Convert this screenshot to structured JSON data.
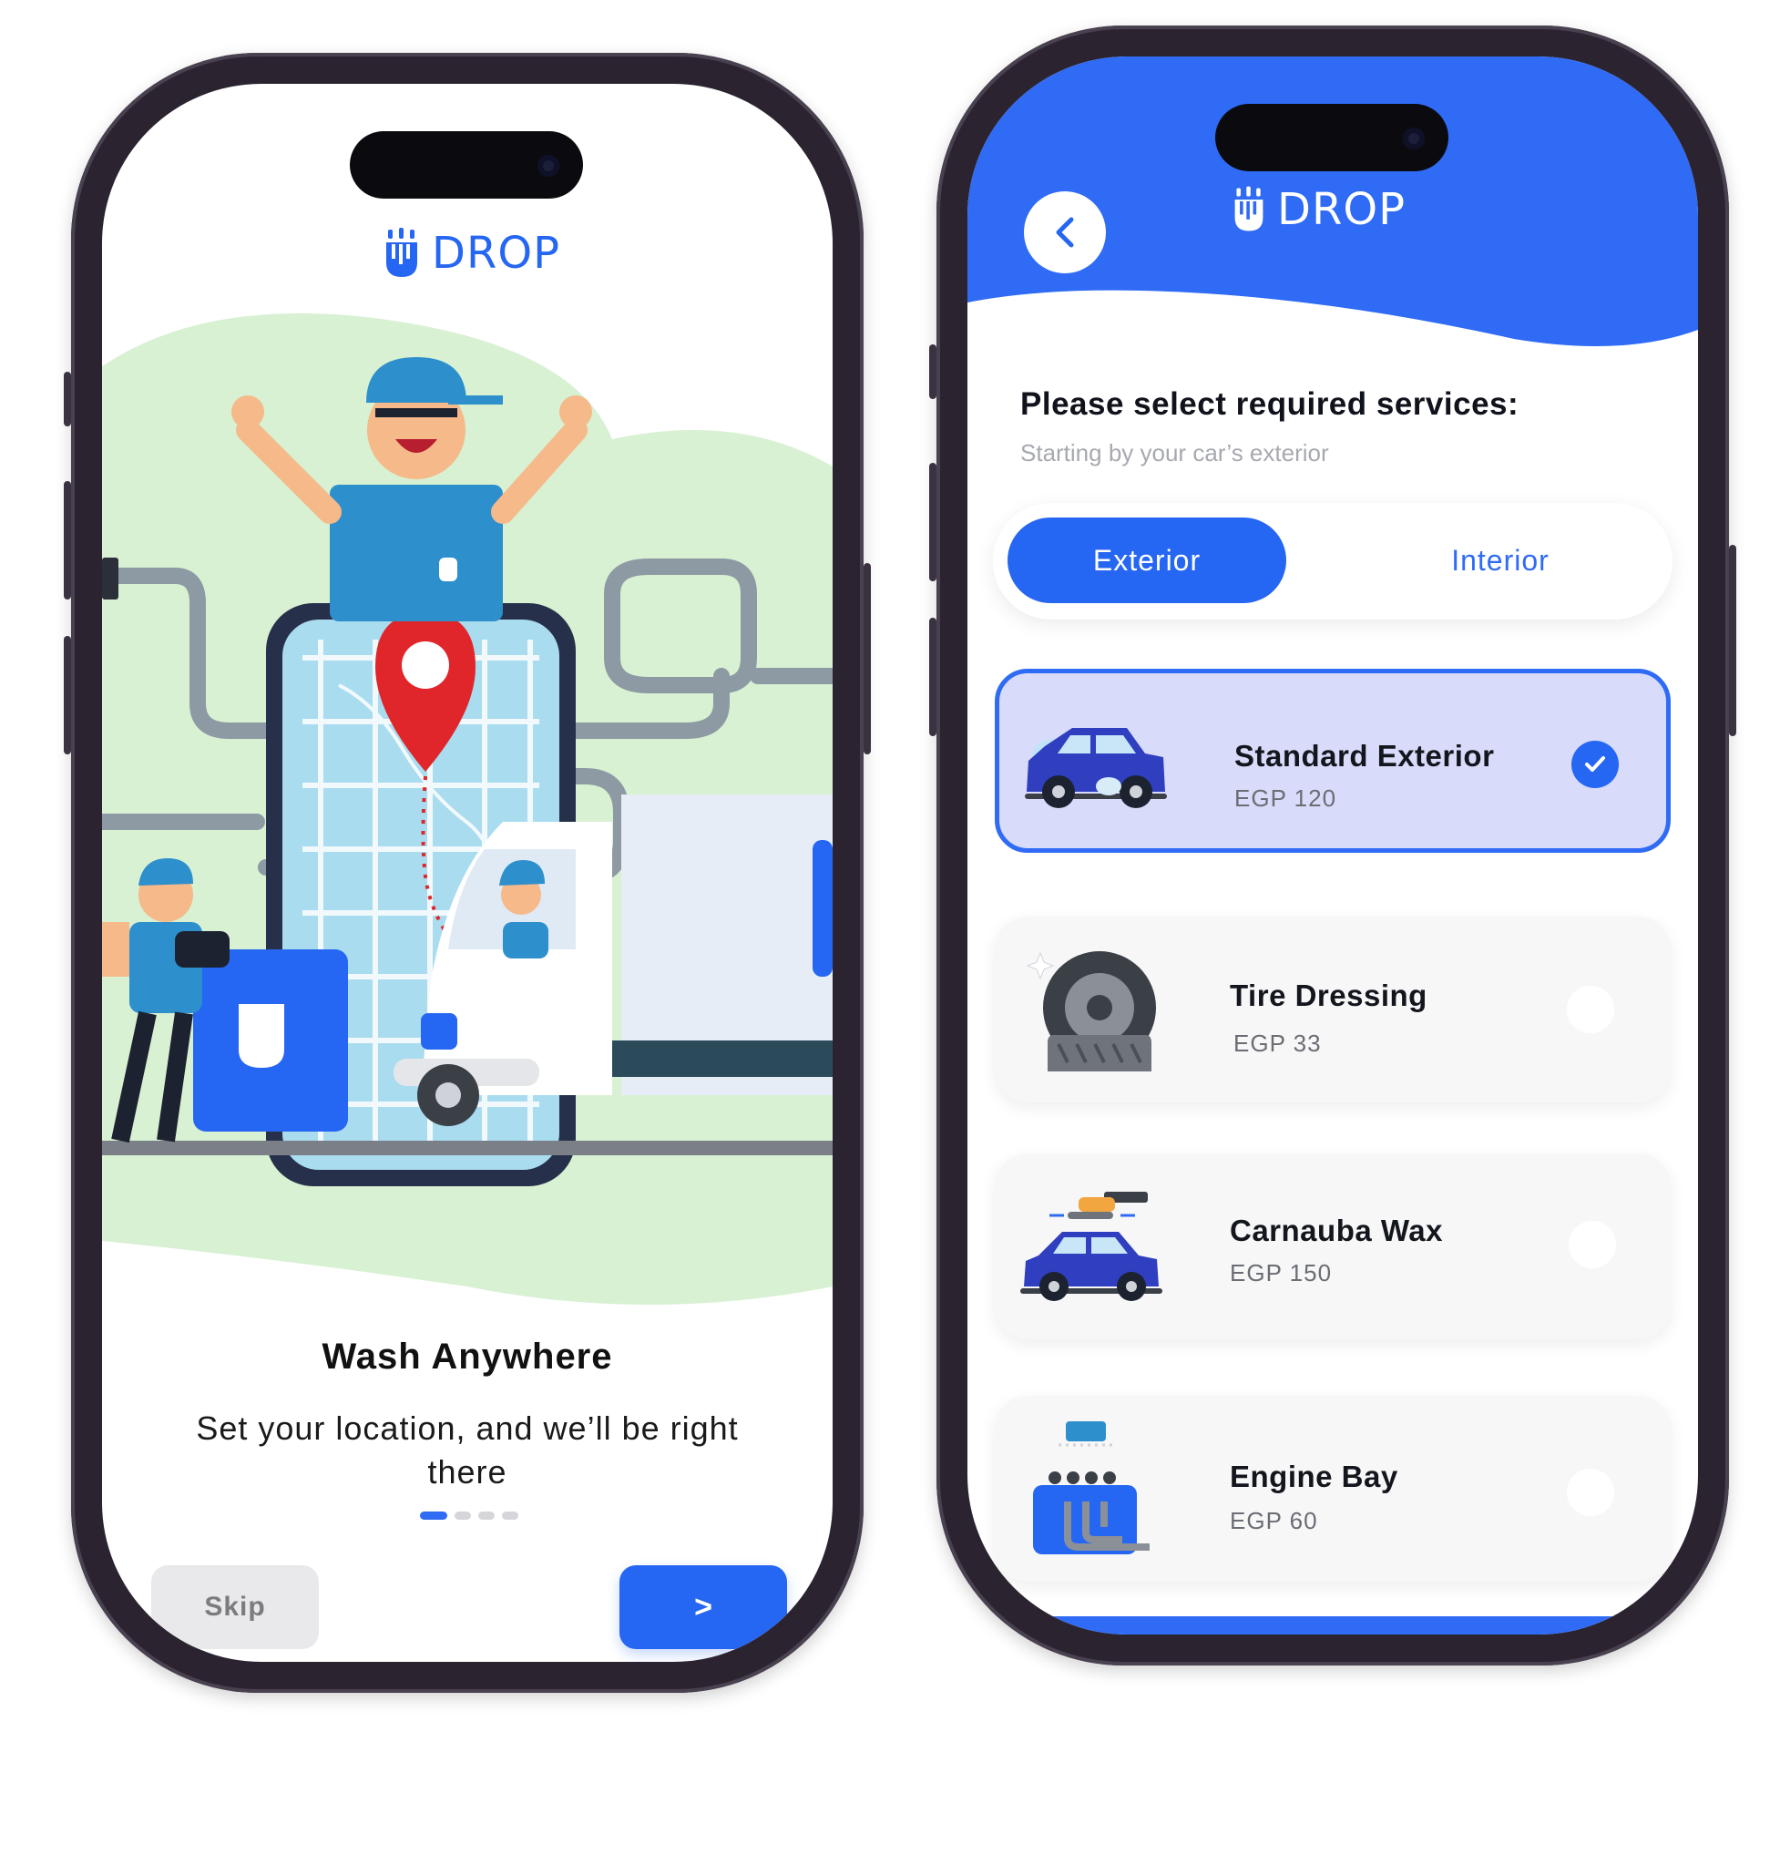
{
  "brand": {
    "name": "DROP",
    "color": "#2566f2"
  },
  "onboarding": {
    "title": "Wash Anywhere",
    "description": "Set your location, and we’ll be right there",
    "page_count": 4,
    "active_page": 1,
    "skip_label": "Skip",
    "next_label": ">"
  },
  "services": {
    "heading": "Please select required services:",
    "subheading": "Starting by your car’s exterior",
    "tabs": [
      {
        "label": "Exterior",
        "active": true
      },
      {
        "label": "Interior",
        "active": false
      }
    ],
    "items": [
      {
        "name": "Standard Exterior",
        "price": "EGP 120",
        "selected": true,
        "icon": "car-wash-icon"
      },
      {
        "name": "Tire Dressing",
        "price": "EGP 33",
        "selected": false,
        "icon": "tire-icon"
      },
      {
        "name": "Carnauba Wax",
        "price": "EGP 150",
        "selected": false,
        "icon": "wax-car-icon"
      },
      {
        "name": "Engine Bay",
        "price": "EGP 60",
        "selected": false,
        "icon": "engine-icon"
      }
    ]
  }
}
